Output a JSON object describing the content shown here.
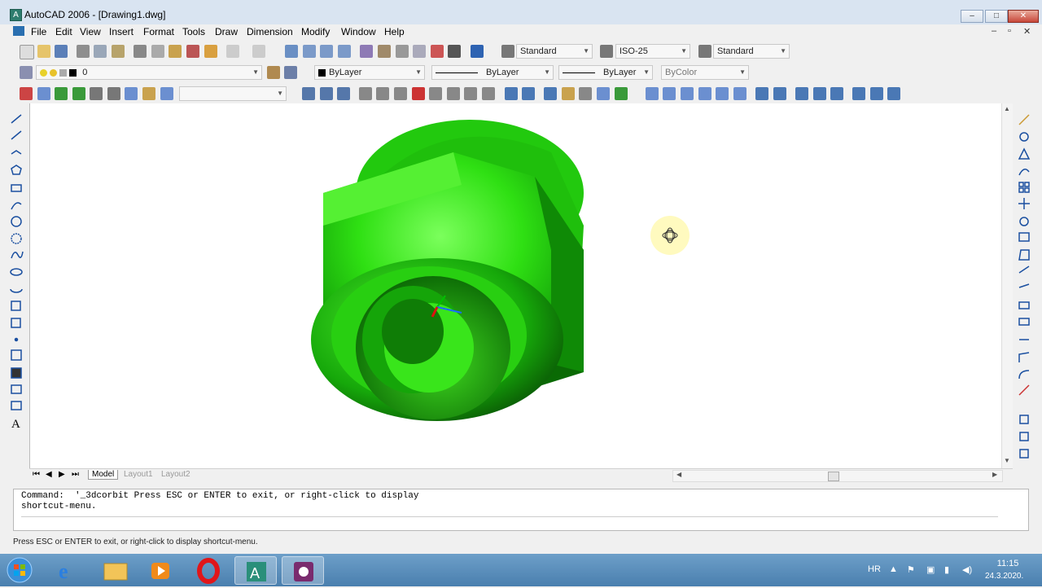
{
  "window": {
    "title": "AutoCAD 2006 - [Drawing1.dwg]",
    "app_icon": "A",
    "controls": [
      "–",
      "□",
      "✕"
    ]
  },
  "menubar": {
    "items": [
      "File",
      "Edit",
      "View",
      "Insert",
      "Format",
      "Tools",
      "Draw",
      "Dimension",
      "Modify",
      "Window",
      "Help"
    ],
    "mdi_controls": [
      "–",
      "▫",
      "✕"
    ]
  },
  "toolbar_styles": {
    "text_style": "Standard",
    "dim_style": "ISO-25",
    "table_style": "Standard"
  },
  "toolbar_layers": {
    "layer_name": "0",
    "color": "ByLayer",
    "linetype": "ByLayer",
    "lineweight": "ByLayer",
    "plotstyle": "ByColor"
  },
  "toolbar_ucs": {
    "ucs_combo_value": ""
  },
  "layout_tabs": [
    "Model",
    "Layout1",
    "Layout2"
  ],
  "command": {
    "history": "Command:  '_3dcorbit Press ESC or ENTER to exit, or right-click to display\nshortcut-menu."
  },
  "status": {
    "prompt": "Press ESC or ENTER to exit, or right-click to display shortcut-menu."
  },
  "taskbar": {
    "language": "HR",
    "time": "11:15",
    "date": "24.3.2020."
  },
  "colors": {
    "model_green": "#2fd80f",
    "background": "#ffffff",
    "taskbar": "#4a7fae"
  },
  "icons": {
    "left_draw_toolbar": [
      "line-icon",
      "construction-line-icon",
      "polyline-icon",
      "polygon-icon",
      "rectangle-icon",
      "arc-icon",
      "circle-icon",
      "revision-cloud-icon",
      "spline-icon",
      "ellipse-icon",
      "ellipse-arc-icon",
      "insert-block-icon",
      "make-block-icon",
      "point-icon",
      "hatch-icon",
      "gradient-icon",
      "region-icon",
      "table-icon",
      "multiline-text-icon"
    ],
    "right_modify_toolbar": [
      "erase-icon",
      "copy-icon",
      "mirror-icon",
      "offset-icon",
      "array-icon",
      "move-icon",
      "rotate-icon",
      "scale-icon",
      "stretch-icon",
      "trim-icon",
      "extend-icon",
      "break-at-point-icon",
      "break-icon",
      "join-icon",
      "chamfer-icon",
      "fillet-icon",
      "explode-icon",
      "draworder-icon",
      "bring-to-front-icon",
      "send-to-back-icon"
    ]
  }
}
